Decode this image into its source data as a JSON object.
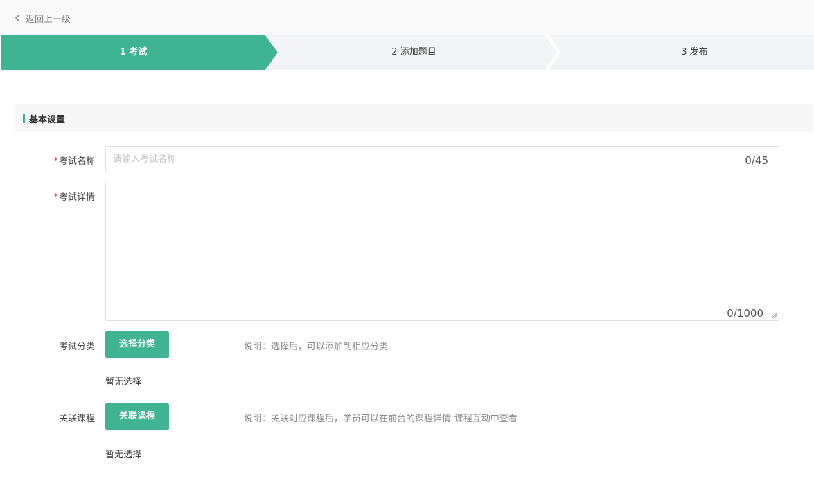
{
  "topbar": {
    "back_label": "返回上一级"
  },
  "steps": [
    {
      "label": "1 考试",
      "active": true
    },
    {
      "label": "2 添加题目",
      "active": false
    },
    {
      "label": "3 发布",
      "active": false
    }
  ],
  "section": {
    "title": "基本设置"
  },
  "form": {
    "required_mark": "*",
    "exam_name": {
      "label": "考试名称",
      "placeholder": "请输入考试名称",
      "value": "",
      "counter": "0/45"
    },
    "exam_detail": {
      "label": "考试详情",
      "value": "",
      "counter": "0/1000"
    },
    "category": {
      "label": "考试分类",
      "button": "选择分类",
      "hint": "说明：选择后，可以添加到相应分类",
      "empty": "暂无选择"
    },
    "course": {
      "label": "关联课程",
      "button": "关联课程",
      "hint": "说明：关联对应课程后，学员可以在前台的课程详情-课程互动中查看",
      "empty": "暂无选择"
    }
  },
  "colors": {
    "accent": "#3fb392",
    "step_inactive": "#f3f4f7",
    "required": "#e4393c"
  }
}
